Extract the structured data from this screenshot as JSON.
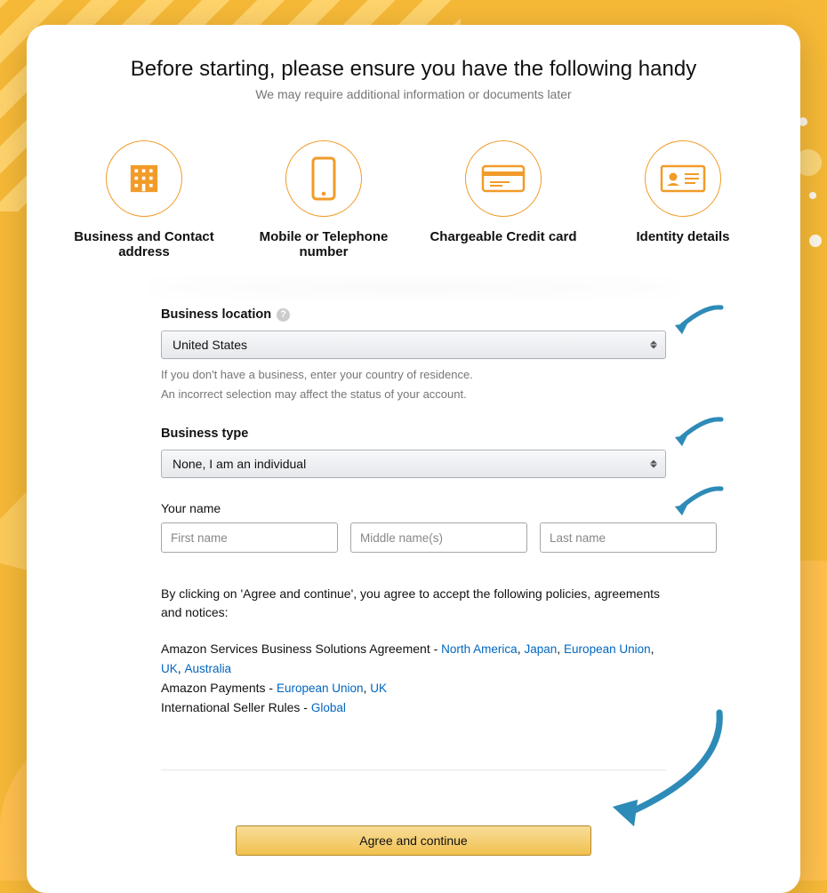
{
  "heading": "Before starting, please ensure you have the following handy",
  "subheading": "We may require additional information or documents later",
  "requirements": [
    {
      "id": "address",
      "label": "Business and Contact address"
    },
    {
      "id": "phone",
      "label": "Mobile or Telephone number"
    },
    {
      "id": "card",
      "label": "Chargeable Credit card"
    },
    {
      "id": "identity",
      "label": "Identity details"
    }
  ],
  "form": {
    "location": {
      "label": "Business location",
      "value": "United States",
      "hint1": "If you don't have a business, enter your country of residence.",
      "hint2": "An incorrect selection may affect the status of your account."
    },
    "type": {
      "label": "Business type",
      "value": "None, I am an individual"
    },
    "name": {
      "label": "Your name",
      "first_ph": "First name",
      "middle_ph": "Middle name(s)",
      "last_ph": "Last name",
      "first": "",
      "middle": "",
      "last": ""
    }
  },
  "agree": {
    "intro": "By clicking on 'Agree and continue', you agree to accept the following policies, agreements and notices:",
    "line1_prefix": "Amazon Services Business Solutions Agreement - ",
    "line1_links": [
      "North America",
      "Japan",
      "European Union",
      "UK",
      "Australia"
    ],
    "line2_prefix": "Amazon Payments - ",
    "line2_links": [
      "European Union",
      "UK"
    ],
    "line3_prefix": "International Seller Rules - ",
    "line3_links": [
      "Global"
    ]
  },
  "submit_label": "Agree and continue"
}
